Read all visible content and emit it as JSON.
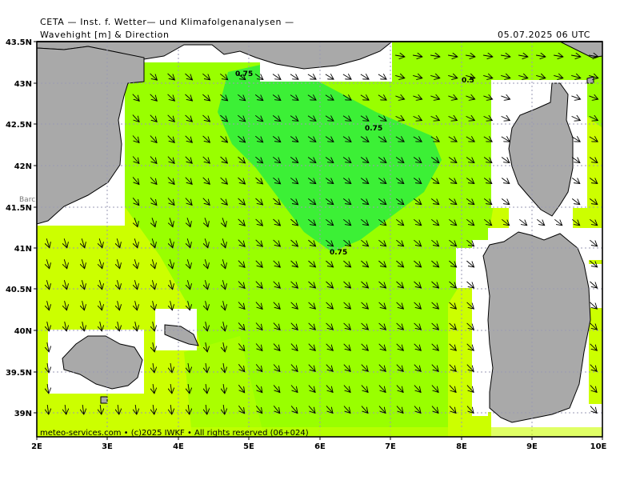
{
  "header": {
    "institute": "CETA — Inst. f. Wetter— und Klimafolgenanalysen —",
    "variable": "Wavehight [m] & Direction",
    "valid_time": "05.07.2025 06 UTC"
  },
  "axes": {
    "lat_labels": [
      "43.5N",
      "43N",
      "42.5N",
      "42N",
      "41.5N",
      "41N",
      "40.5N",
      "40N",
      "39.5N",
      "39N"
    ],
    "lon_labels": [
      "2E",
      "3E",
      "4E",
      "5E",
      "6E",
      "7E",
      "8E",
      "9E",
      "10E"
    ],
    "lat_range": [
      38.75,
      43.5
    ],
    "lon_range": [
      2,
      10
    ]
  },
  "contours": {
    "label_upper": "0.75",
    "label_center": "0.75",
    "label_lower": "0.75",
    "label_east": "0.5"
  },
  "places": {
    "barcelona_partial": "Barc"
  },
  "footer": {
    "credit": "meteo-services.com • (c)2025 IWKF • All rights reserved (06+024)"
  },
  "colors": {
    "land": "#a9a9a9",
    "sea_low": "#ccff00",
    "sea_mid": "#99ff00",
    "sea_high": "#3cf036",
    "missing": "#ffffff",
    "grid": "#9a9ab4"
  },
  "wave_direction": "north-west to south-east"
}
